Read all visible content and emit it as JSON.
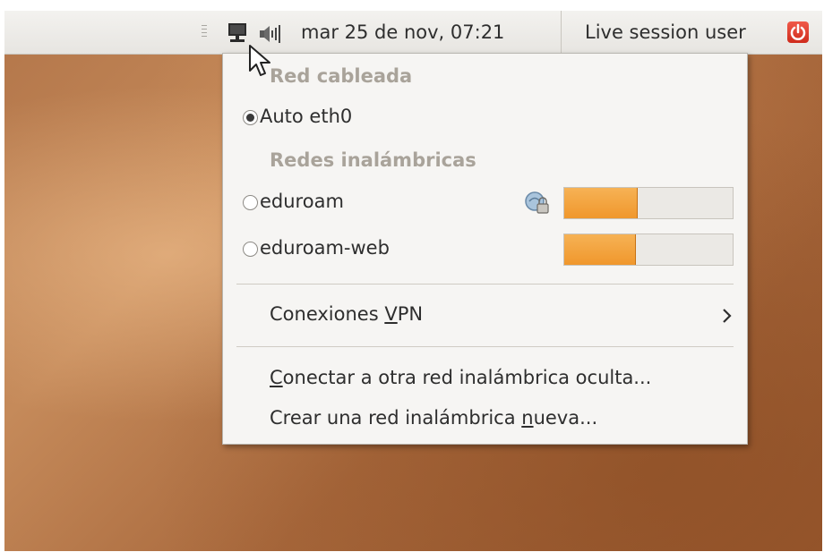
{
  "panel": {
    "clock": "mar 25 de nov, 07:21",
    "user": "Live session user",
    "icons": [
      "network-wired-icon",
      "volume-icon",
      "power-icon"
    ]
  },
  "menu": {
    "wired_header": "Red cableada",
    "wired": [
      {
        "label": "Auto eth0",
        "checked": true
      }
    ],
    "wireless_header": "Redes inalámbricas",
    "wireless": [
      {
        "label": "eduroam",
        "secured": true,
        "signal": 0.43
      },
      {
        "label": "eduroam-web",
        "secured": false,
        "signal": 0.42
      }
    ],
    "vpn": {
      "pre": "Conexiones ",
      "mnemonic": "V",
      "post": "PN"
    },
    "hidden_network": {
      "pre": "",
      "mnemonic": "C",
      "post": "onectar a otra red inalámbrica oculta..."
    },
    "new_network": {
      "pre": "Crear una red inalámbrica ",
      "mnemonic": "n",
      "post": "ueva..."
    }
  },
  "colors": {
    "signal": "#f0972c",
    "power": "#d8301f",
    "header": "#a9a39a"
  }
}
